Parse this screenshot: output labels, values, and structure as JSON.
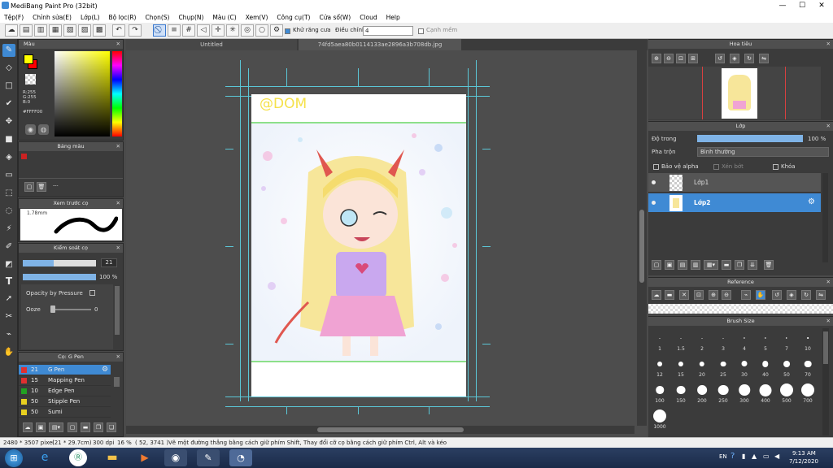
{
  "window": {
    "title": "MediBang Paint Pro (32bit)",
    "minimize": "—",
    "maximize": "☐",
    "close": "✕"
  },
  "menu": [
    "Tệp(F)",
    "Chỉnh sửa(E)",
    "Lớp(L)",
    "Bộ lọc(R)",
    "Chọn(S)",
    "Chụp(N)",
    "Màu (C)",
    "Xem(V)",
    "Công cụ(T)",
    "Cửa sổ(W)",
    "Cloud",
    "Help"
  ],
  "toolbar": {
    "antialias_label": "Khử răng cưa",
    "correction_label": "Điều chỉnh",
    "correction_value": "4",
    "snap_label": "Cạnh mềm"
  },
  "tabs": {
    "untitled": "Untitled",
    "file": "74fd5aea80b0114133ae2896a3b708db.jpg"
  },
  "color_panel": {
    "title": "Màu",
    "r": "R:255",
    "g": "G:255",
    "b": "B:0",
    "hex": "#FFFF00",
    "primary": "#ffff00",
    "secondary": "#ff0000"
  },
  "palette_panel": {
    "title": "Bảng màu",
    "swatch": "#cc2222",
    "more": "---"
  },
  "brush_preview": {
    "title": "Xem trước cọ",
    "size": "1.78mm"
  },
  "brush_control": {
    "title": "Kiểm soát cọ",
    "size_value": "21",
    "size_fraction": 0.42,
    "opacity_value": "100 %",
    "opacity_fraction": 1.0,
    "opacity_pressure": "Opacity by Pressure",
    "ooze_label": "Ooze",
    "ooze_value": "0",
    "ooze_fraction": 0.0
  },
  "brush_list": {
    "title": "Cọ: G Pen",
    "items": [
      {
        "size": "21",
        "name": "G Pen",
        "color": "#e03030",
        "selected": true
      },
      {
        "size": "15",
        "name": "Mapping Pen",
        "color": "#e03030",
        "selected": false
      },
      {
        "size": "10",
        "name": "Edge Pen",
        "color": "#22a022",
        "selected": false
      },
      {
        "size": "50",
        "name": "Stipple Pen",
        "color": "#e8d020",
        "selected": false
      },
      {
        "size": "50",
        "name": "Sumi",
        "color": "#e8d020",
        "selected": false
      }
    ]
  },
  "navigator": {
    "title": "Hoa tiêu"
  },
  "layer_panel": {
    "title": "Lớp",
    "opacity_label": "Độ trong",
    "opacity_value": "100 %",
    "opacity_fraction": 1.0,
    "blend_label": "Pha trộn",
    "blend_value": "Bình thường",
    "protect_alpha": "Bảo vệ alpha",
    "clipping": "Xén bớt",
    "lock": "Khóa",
    "layers": [
      {
        "name": "Lớp1",
        "selected": false
      },
      {
        "name": "Lớp2",
        "selected": true
      }
    ]
  },
  "reference_panel": {
    "title": "Reference"
  },
  "brush_size_panel": {
    "title": "Brush Size",
    "sizes": [
      "1",
      "1.5",
      "2",
      "3",
      "4",
      "5",
      "7",
      "10",
      "12",
      "15",
      "20",
      "25",
      "30",
      "40",
      "50",
      "70",
      "100",
      "150",
      "200",
      "250",
      "300",
      "400",
      "500",
      "700",
      "1000"
    ]
  },
  "canvas": {
    "signature": "@DOM"
  },
  "statusbar": {
    "dimensions": "2480 * 3507 pixel",
    "paper": "(21 * 29.7cm)",
    "dpi": "300 dpi",
    "zoom": "16 %",
    "coords": "( 52, 3741 )",
    "hint": "Vẽ một đường thẳng bằng cách giữ phím Shift, Thay đổi cỡ cọ bằng cách giữ phím Ctrl, Alt và kéo"
  },
  "taskbar": {
    "language": "EN",
    "time": "9:13 AM",
    "date": "7/12/2020"
  },
  "colors": {
    "accent": "#3f8ad4",
    "guide": "#5bc6d6"
  }
}
